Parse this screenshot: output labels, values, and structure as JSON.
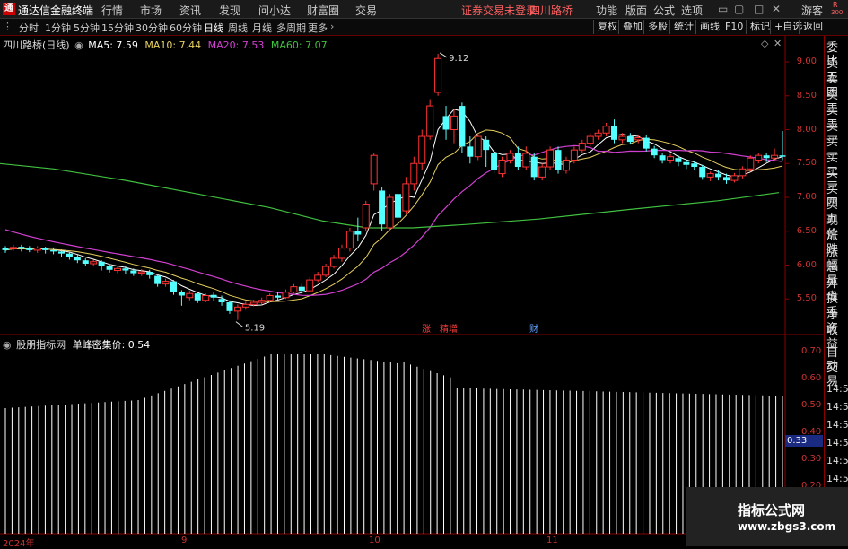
{
  "titlebar": {
    "app_title": "通达信金融终端",
    "menus": [
      "行情",
      "市场",
      "资讯",
      "发现",
      "问小达",
      "财富圈",
      "交易"
    ],
    "status": "证券交易未登录",
    "stock_name": "四川路桥",
    "right_menus": [
      "功能",
      "版面",
      "公式",
      "选项"
    ],
    "guest": "游客",
    "badge_r": "R",
    "badge_num": "300"
  },
  "toolbar": {
    "periods": [
      "分时",
      "1分钟",
      "5分钟",
      "15分钟",
      "30分钟",
      "60分钟",
      "日线",
      "周线",
      "月线",
      "多周期",
      "更多"
    ],
    "active": "日线",
    "right_buttons": [
      "复权",
      "叠加",
      "多股",
      "统计",
      "画线",
      "F10",
      "标记",
      "+自选",
      "返回"
    ]
  },
  "main_chart": {
    "header_name": "四川路桥(日线)",
    "ma_labels": [
      {
        "text": "MA5: 7.59",
        "color": "#ffffff"
      },
      {
        "text": "MA10: 7.44",
        "color": "#e6d060"
      },
      {
        "text": "MA20: 7.53",
        "color": "#d040d0"
      },
      {
        "text": "MA60: 7.07",
        "color": "#40c040"
      }
    ],
    "y_ticks": [
      "9.00",
      "8.50",
      "8.00",
      "7.50",
      "7.00",
      "6.50",
      "6.00",
      "5.50"
    ],
    "high_annotation": "9.12",
    "low_annotation": "5.19",
    "event_labels": [
      {
        "text": "涨",
        "color": "#ff4040"
      },
      {
        "text": "精增",
        "color": "#ff4040"
      },
      {
        "text": "财",
        "color": "#60a0ff"
      }
    ]
  },
  "sub_chart": {
    "header_name": "股朋指标网",
    "indicator": "单峰密集价: 0.54",
    "y_ticks": [
      "0.70",
      "0.60",
      "0.50",
      "0.40",
      "0.30",
      "0.20"
    ],
    "current_value": "0.33"
  },
  "x_axis": [
    "2024年",
    "9",
    "10",
    "11"
  ],
  "side_panel": {
    "quote_items": [
      "委比",
      "卖五",
      "卖四",
      "卖三",
      "卖二",
      "卖一",
      "买一",
      "买二",
      "买三",
      "买四",
      "买五",
      "现价",
      "涨跌",
      "涨幅",
      "总量",
      "外盘",
      "换手",
      "净资",
      "收益"
    ],
    "bottom_items": [
      "自动",
      "交易"
    ],
    "time_items": [
      "14:56",
      "14:56",
      "14:56",
      "14:56",
      "14:56",
      "14:56",
      "14:56",
      "14:56"
    ]
  },
  "watermark": {
    "line1": "指标公式网",
    "line2": "www.zbgs3.com"
  },
  "colors": {
    "up": "#ff3333",
    "down": "#54ffff",
    "axis": "#cc3333"
  }
}
